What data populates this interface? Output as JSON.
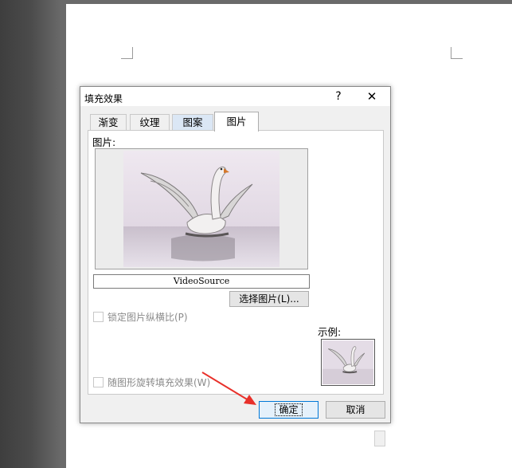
{
  "dialog": {
    "title": "填充效果",
    "help": "?",
    "close": "✕"
  },
  "tabs": [
    {
      "label": "渐变"
    },
    {
      "label": "纹理"
    },
    {
      "label": "图案"
    },
    {
      "label": "图片",
      "active": true
    }
  ],
  "picture_panel": {
    "picture_label": "图片:",
    "source_name": "VideoSource",
    "select_button": "选择图片(L)...",
    "lock_aspect_label": "锁定图片纵横比(P)",
    "sample_label": "示例:",
    "rotate_label": "随图形旋转填充效果(W)"
  },
  "buttons": {
    "ok": "确定",
    "cancel": "取消"
  },
  "colors": {
    "accent": "#0078d7",
    "arrow": "#e8302a"
  }
}
